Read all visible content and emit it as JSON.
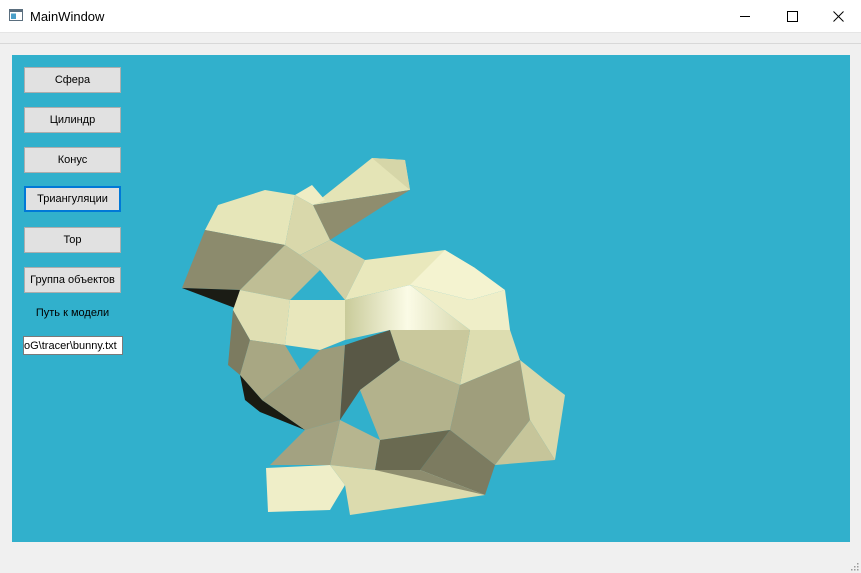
{
  "window": {
    "title": "MainWindow"
  },
  "sidebar": {
    "buttons": [
      {
        "label": "Сфера"
      },
      {
        "label": "Цилиндр"
      },
      {
        "label": "Конус"
      },
      {
        "label": "Триангуляции"
      },
      {
        "label": "Тор"
      },
      {
        "label": "Группа объектов"
      }
    ],
    "path_label": "Путь  к модели",
    "path_value": "oG\\tracer\\bunny.txt"
  },
  "viewport": {
    "background_color": "#31b0cc",
    "model_color": "#e8e6b8",
    "model": "bunny"
  }
}
